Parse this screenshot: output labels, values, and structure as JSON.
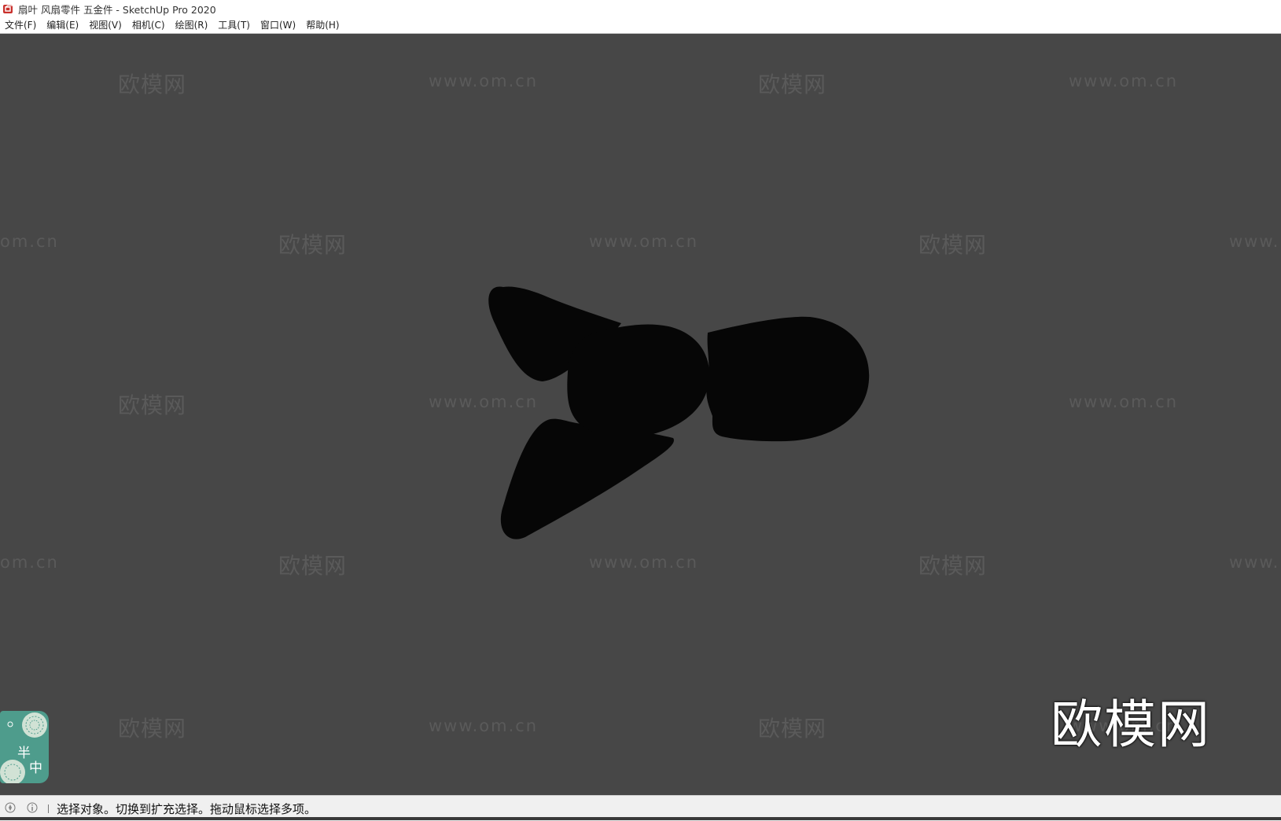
{
  "window": {
    "title": "扇叶 风扇零件 五金件 - SketchUp Pro 2020"
  },
  "menu": {
    "items": [
      "文件(F)",
      "编辑(E)",
      "视图(V)",
      "相机(C)",
      "绘图(R)",
      "工具(T)",
      "窗口(W)",
      "帮助(H)"
    ]
  },
  "watermark": {
    "brand": "欧模网",
    "url": "www.om.cn",
    "url_partial_left": "om.cn",
    "url_partial_right": "www.",
    "big": "欧模网",
    "big_url": "www.om.cn"
  },
  "badge": {
    "char1": "半",
    "char2": "中"
  },
  "status": {
    "text": "选择对象。切换到扩充选择。拖动鼠标选择多项。"
  },
  "colors": {
    "viewport": "#474747",
    "model": "#060606",
    "badge": "#4e9c8c"
  }
}
